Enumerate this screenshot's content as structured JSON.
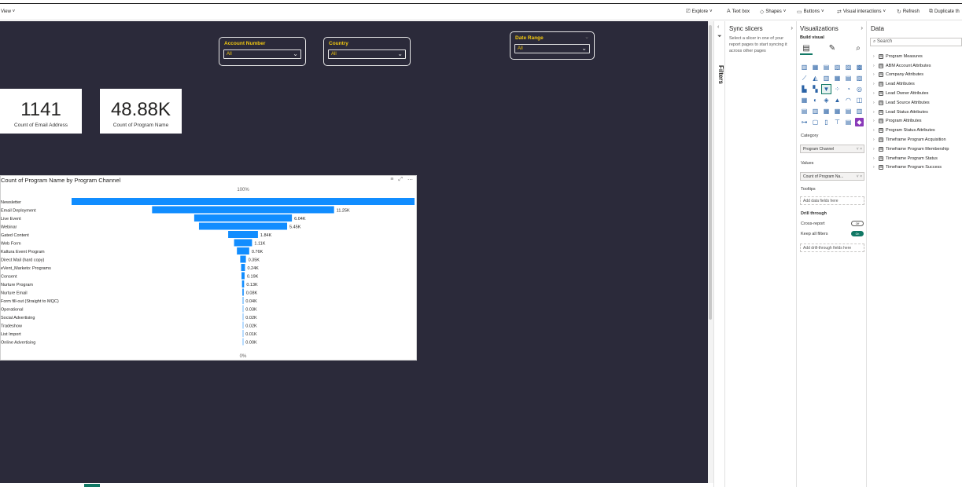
{
  "ribbon": {
    "view_label": "View",
    "buttons": [
      {
        "label": "Explore",
        "icon": "explore-icon",
        "glyph": "⎚",
        "chevron": "˅"
      },
      {
        "label": "Text box",
        "icon": "textbox-icon",
        "glyph": "A",
        "chevron": ""
      },
      {
        "label": "Shapes",
        "icon": "shapes-icon",
        "glyph": "◇",
        "chevron": "˅"
      },
      {
        "label": "Buttons",
        "icon": "buttons-icon",
        "glyph": "▭",
        "chevron": "˅"
      },
      {
        "label": "Visual interactions",
        "icon": "visual-interactions-icon",
        "glyph": "⇄",
        "chevron": "˅"
      },
      {
        "label": "Refresh",
        "icon": "refresh-icon",
        "glyph": "↻",
        "chevron": ""
      },
      {
        "label": "Duplicate th",
        "icon": "duplicate-icon",
        "glyph": "⧉",
        "chevron": ""
      }
    ]
  },
  "slicers": [
    {
      "title": "Account Number",
      "value": "All"
    },
    {
      "title": "Country",
      "value": "All"
    },
    {
      "title": "Date Range",
      "value": "All"
    }
  ],
  "cards": [
    {
      "value": "1141",
      "label": "Count of Email Address"
    },
    {
      "value": "48.88K",
      "label": "Count of Program Name"
    }
  ],
  "chart_data": {
    "type": "funnel",
    "title": "Count of Program Name by Program Channel",
    "top_label": "100%",
    "bottom_label": "0%",
    "color": "#118dff",
    "categories": [
      "Newsletter",
      "Email Deployment",
      "Live Event",
      "Webinar",
      "Gated Content",
      "Web Form",
      "Kaltura Event Program",
      "Direct Mail (hard copy)",
      "eVent_Marketo: Programs",
      "Consent",
      "Nurture Program",
      "Nurture Email",
      "Form fill-out (Straight to MQC)",
      "Operational",
      "Social Advertising",
      "Tradeshow",
      "List Import",
      "Online Advertising"
    ],
    "values": [
      21.2,
      11.25,
      6.04,
      5.45,
      1.84,
      1.11,
      0.76,
      0.35,
      0.24,
      0.19,
      0.13,
      0.08,
      0.04,
      0.03,
      0.02,
      0.02,
      0.01,
      0.0
    ],
    "value_labels": [
      "",
      "11.25K",
      "6.04K",
      "5.45K",
      "1.84K",
      "1.11K",
      "0.76K",
      "0.35K",
      "0.24K",
      "0.19K",
      "0.13K",
      "0.08K",
      "0.04K",
      "0.03K",
      "0.02K",
      "0.02K",
      "0.01K",
      "0.00K"
    ]
  },
  "filters_pane": {
    "label": "Filters"
  },
  "sync_slicers": {
    "title": "Sync slicers",
    "description": "Select a slicer in one of your report pages to start syncing it across other pages"
  },
  "visualizations": {
    "title": "Visualizations",
    "build_visual": "Build visual",
    "category_label": "Category",
    "category_field": "Program Channel",
    "values_label": "Values",
    "values_field": "Count of Program Na...",
    "tooltips_label": "Tooltips",
    "tooltips_placeholder": "Add data fields here",
    "drill_through_label": "Drill through",
    "cross_report_label": "Cross-report",
    "cross_report_state": "Off",
    "keep_all_filters_label": "Keep all filters",
    "keep_all_filters_state": "On",
    "drill_placeholder": "Add drill-through fields here"
  },
  "data_pane": {
    "title": "Data",
    "search_placeholder": "Search",
    "tables": [
      "Program Measures",
      "ABM Account Attributes",
      "Company Attributes",
      "Lead Attributes",
      "Lead Owner Attributes",
      "Lead Source Attributes",
      "Lead Status Attributes",
      "Program Attributes",
      "Program Status Attributes",
      "Timeframe Program Acquisition",
      "Timeframe Program Membership",
      "Timeframe Program Status",
      "Timeframe Program Success"
    ]
  }
}
